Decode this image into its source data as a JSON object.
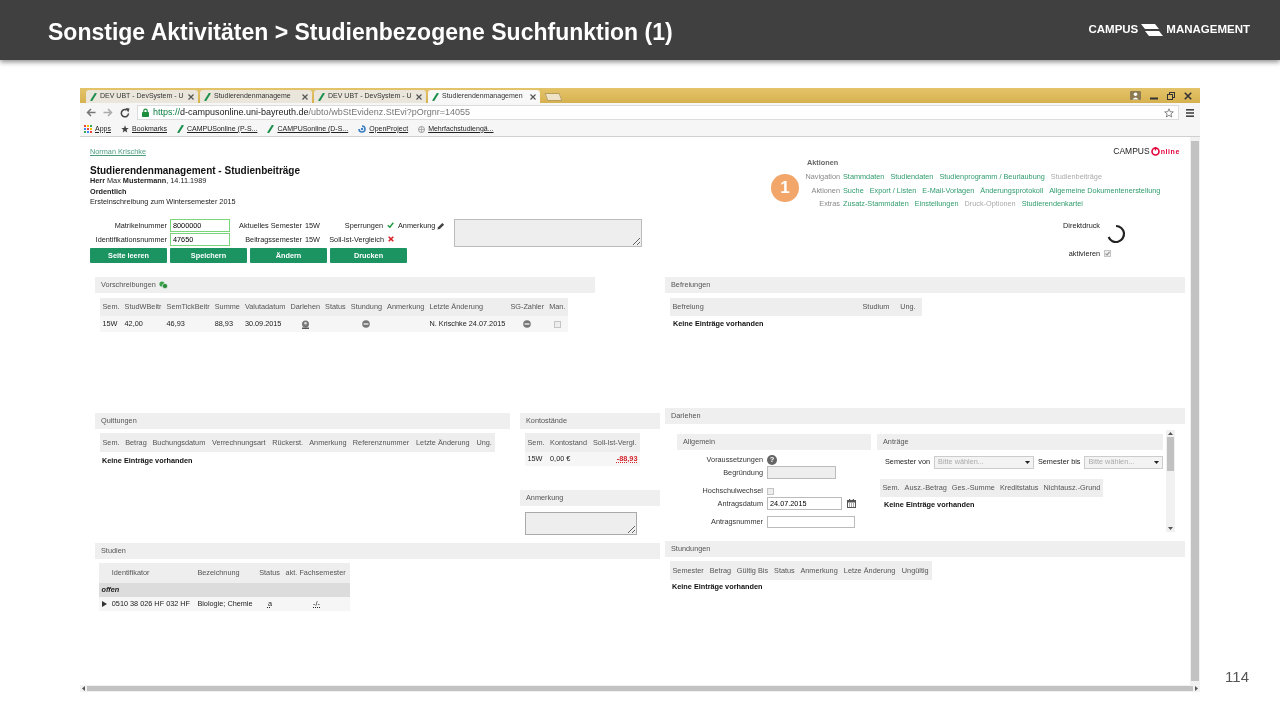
{
  "slide": {
    "title": "Sonstige Aktivitäten > Studienbezogene Suchfunktion (1)",
    "logo": [
      "CAMPUS",
      "MANAGEMENT"
    ],
    "page_number": "114",
    "marker": "1"
  },
  "browser": {
    "tabs": [
      {
        "title": "DEV UBT - DevSystem - U",
        "selected": false
      },
      {
        "title": "Studierendenmanageme",
        "selected": false
      },
      {
        "title": "DEV UBT - DevSystem - U",
        "selected": false
      },
      {
        "title": "Studierendenmanagemen",
        "selected": true
      }
    ],
    "url": {
      "scheme": "https://",
      "host": "d-campusonline.uni-bayreuth.de",
      "path": "/ubto/wbStEvidenz.StEvi?pOrgnr=14055"
    },
    "bookmarks": [
      {
        "kind": "apps",
        "label": "Apps"
      },
      {
        "kind": "star",
        "label": "Bookmarks"
      },
      {
        "kind": "campus",
        "label": "CAMPUSonline (P-S..."
      },
      {
        "kind": "campus",
        "label": "CAMPUSonline (D-S..."
      },
      {
        "kind": "project",
        "label": "OpenProject"
      },
      {
        "kind": "page",
        "label": "Mehrfachstudiengä..."
      }
    ]
  },
  "page": {
    "user": "Norman Krischke",
    "product_logo": {
      "prefix": "CAMPUS",
      "suffix": "nline"
    },
    "heading": "Studierendenmanagement - Studienbeiträge",
    "person": "**Herr** Max **Mustermann**, 14.11.1989",
    "status": "Ordentlich",
    "enrollment": "Ersteinschreibung zum Wintersemester 2015",
    "form": {
      "rows": [
        {
          "label": "Matrikelnummer",
          "value": "8000000",
          "semester_label": "Aktuelles Semester",
          "semester": "15W",
          "check_label": "Sperrungen",
          "ok": true
        },
        {
          "label": "Identifikationsnummer",
          "value": "47650",
          "semester_label": "Beitragssemester",
          "semester": "15W",
          "check_label": "Soll-Ist-Vergleich",
          "ok": false
        }
      ],
      "remark_label": "Anmerkung"
    },
    "buttons": [
      "Seite leeren",
      "Speichern",
      "Ändern",
      "Drucken"
    ],
    "actions": {
      "title": "Aktionen",
      "rows": [
        {
          "label": "Navigation",
          "links": [
            {
              "text": "Stammdaten",
              "disabled": false
            },
            {
              "text": "Studiendaten",
              "disabled": false
            },
            {
              "text": "Studienprogramm / Beurlaubung",
              "disabled": false
            },
            {
              "text": "Studienbeiträge",
              "disabled": true
            }
          ]
        },
        {
          "label": "Aktionen",
          "links": [
            {
              "text": "Suche",
              "disabled": false
            },
            {
              "text": "Export / Listen",
              "disabled": false
            },
            {
              "text": "E-Mail-Vorlagen",
              "disabled": false
            },
            {
              "text": "Änderungsprotokoll",
              "disabled": false
            },
            {
              "text": "Allgemeine Dokumentenerstellung",
              "disabled": false
            }
          ]
        },
        {
          "label": "Extras",
          "links": [
            {
              "text": "Zusatz-Stammdaten",
              "disabled": false
            },
            {
              "text": "Einstellungen",
              "disabled": false
            },
            {
              "text": "Druck-Optionen",
              "disabled": true
            },
            {
              "text": "Studierendenkartei",
              "disabled": false
            }
          ]
        }
      ]
    },
    "direct_print": {
      "label": "Direktdruck",
      "loading": true,
      "option_label": "aktivieren",
      "checked": true,
      "disabled": true
    }
  },
  "vorschreibungen": {
    "title": "Vorschreibungen",
    "columns": [
      "Sem.",
      "StudWBeitr",
      "SemTickBeitr",
      "Summe",
      "Valutadatum",
      "Darlehen",
      "Status",
      "Stundung",
      "Anmerkung",
      "Letzte Änderung",
      "SG-Zahler",
      "Man."
    ],
    "rows": [
      {
        "cells": [
          {
            "kind": "text",
            "text": "15W"
          },
          {
            "kind": "text",
            "text": "42,00"
          },
          {
            "kind": "text",
            "text": "46,93"
          },
          {
            "kind": "text",
            "text": "88,93"
          },
          {
            "kind": "text",
            "text": "30.09.2015"
          },
          {
            "kind": "stamp"
          },
          {
            "kind": "blank"
          },
          {
            "kind": "minus"
          },
          {
            "kind": "blank"
          },
          {
            "kind": "text",
            "text": "N. Krischke 24.07.2015"
          },
          {
            "kind": "minus"
          },
          {
            "kind": "checkbox",
            "checked": false
          }
        ]
      }
    ]
  },
  "quittungen": {
    "title": "Quittungen",
    "columns": [
      "Sem.",
      "Betrag",
      "Buchungsdatum",
      "Verrechnungsart",
      "Rückerst.",
      "Anmerkung",
      "Referenznummer",
      "Letzte Änderung",
      "Ung."
    ],
    "empty_text": "Keine Einträge vorhanden"
  },
  "kontostaende": {
    "title": "Kontostände",
    "columns": [
      "Sem.",
      "Kontostand",
      "Soll-Ist-Vergl."
    ],
    "rows": [
      {
        "cells": [
          {
            "text": "15W",
            "negative": false
          },
          {
            "text": "0,00 €",
            "negative": false
          },
          {
            "text": "-88,93",
            "negative": true
          }
        ]
      }
    ]
  },
  "anmerkung": {
    "title": "Anmerkung"
  },
  "studien": {
    "title": "Studien",
    "columns": [
      "Identifikator",
      "Bezeichnung",
      "Status",
      "akt. Fachsemester"
    ],
    "groups": [
      {
        "label": "offen",
        "rows": [
          {
            "expanded": false,
            "cells": [
              "0510 38 026 HF 032 HF",
              "Biologie; Chemie",
              "a",
              "-/-"
            ]
          }
        ]
      }
    ]
  },
  "befreiungen": {
    "title": "Befreiungen",
    "columns": [
      "Befreiung",
      "Studium",
      "Ung."
    ],
    "empty_text": "Keine Einträge vorhanden"
  },
  "darlehen": {
    "title": "Darlehen",
    "general": {
      "title": "Allgemein",
      "fields": [
        {
          "kind": "help",
          "label": "Voraussetzungen",
          "icon": "?"
        },
        {
          "kind": "textarea",
          "label": "Begründung"
        },
        {
          "kind": "checkbox",
          "label": "Hochschulwechsel",
          "checked": false
        },
        {
          "kind": "date",
          "label": "Antragsdatum",
          "value": "24.07.2015"
        },
        {
          "kind": "text",
          "label": "Antragsnummer"
        }
      ]
    },
    "applications": {
      "title": "Anträge",
      "filters": [
        {
          "label": "Semester von",
          "placeholder": "Bitte wählen..."
        },
        {
          "label": "Semester bis",
          "placeholder": "Bitte wählen..."
        }
      ],
      "columns": [
        "Sem.",
        "Ausz.-Betrag",
        "Ges.-Summe",
        "Kreditstatus",
        "Nichtausz.-Grund"
      ],
      "empty_text": "Keine Einträge vorhanden"
    }
  },
  "stundungen": {
    "title": "Stundungen",
    "columns": [
      "Semester",
      "Betrag",
      "Gültig Bis",
      "Status",
      "Anmerkung",
      "Letze Änderung",
      "Ungültig"
    ],
    "empty_text": "Keine Einträge vorhanden"
  }
}
